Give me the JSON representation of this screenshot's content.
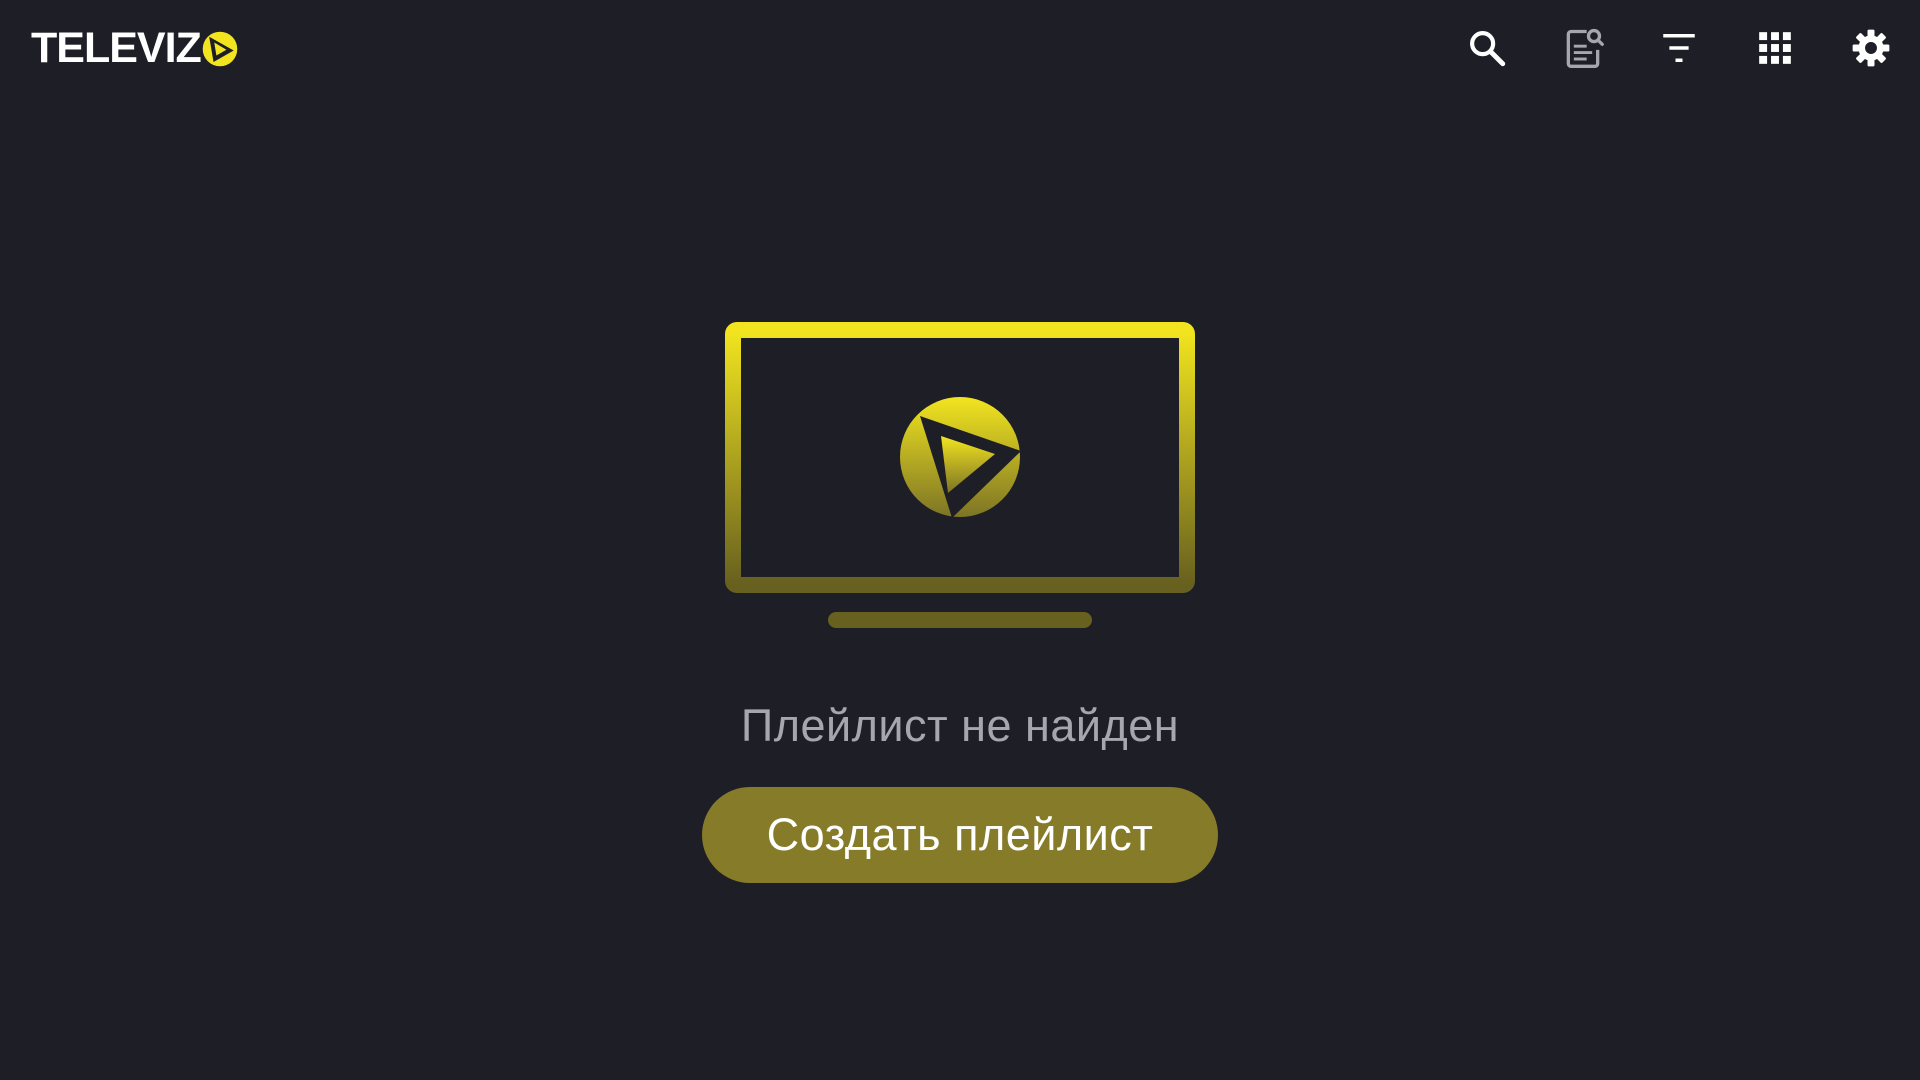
{
  "header": {
    "logo_text": "TELEVIZ",
    "logo_icon": "televizo-play-logo-icon",
    "actions": [
      {
        "id": "search",
        "icon": "search-icon"
      },
      {
        "id": "epg-search",
        "icon": "document-search-icon"
      },
      {
        "id": "filter",
        "icon": "filter-icon"
      },
      {
        "id": "grid",
        "icon": "grid-icon"
      },
      {
        "id": "settings",
        "icon": "gear-icon"
      }
    ]
  },
  "empty_state": {
    "illustration_icon": "tv-play-icon",
    "message": "Плейлист не найден",
    "create_button_label": "Создать плейлист"
  },
  "colors": {
    "background": "#1e1e26",
    "accent": "#f2e51f",
    "accent_dim": "#67601f",
    "button": "#867b28",
    "text_muted": "#a6a6ad",
    "icon": "#ffffff"
  }
}
